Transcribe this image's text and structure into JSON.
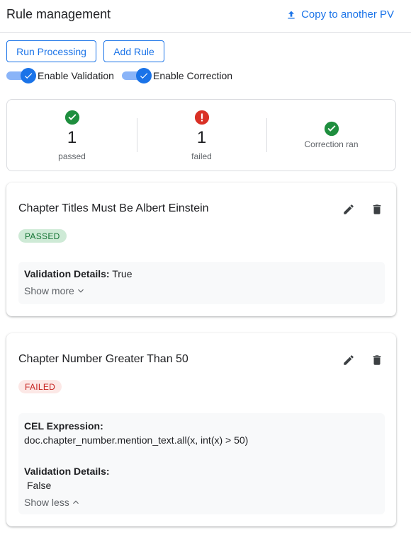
{
  "header": {
    "title": "Rule management",
    "copy_label": "Copy to another PV"
  },
  "actions": {
    "run_label": "Run Processing",
    "add_label": "Add Rule"
  },
  "toggles": {
    "validation_label": "Enable Validation",
    "correction_label": "Enable Correction"
  },
  "summary": {
    "passed_count": "1",
    "passed_label": "passed",
    "failed_count": "1",
    "failed_label": "failed",
    "correction_label": "Correction ran"
  },
  "rules": [
    {
      "title": "Chapter Titles Must Be Albert Einstein",
      "status": "PASSED",
      "validation_label": "Validation Details:",
      "validation_value": "True",
      "toggle_label": "Show more"
    },
    {
      "title": "Chapter Number Greater Than 50",
      "status": "FAILED",
      "cel_label": "CEL Expression:",
      "cel_value": "doc.chapter_number.mention_text.all(x, int(x) > 50)",
      "validation_label": "Validation Details:",
      "validation_value": "False",
      "toggle_label": "Show less"
    }
  ],
  "colors": {
    "accent": "#1a73e8",
    "success": "#1e8e3e",
    "error": "#d93025"
  }
}
